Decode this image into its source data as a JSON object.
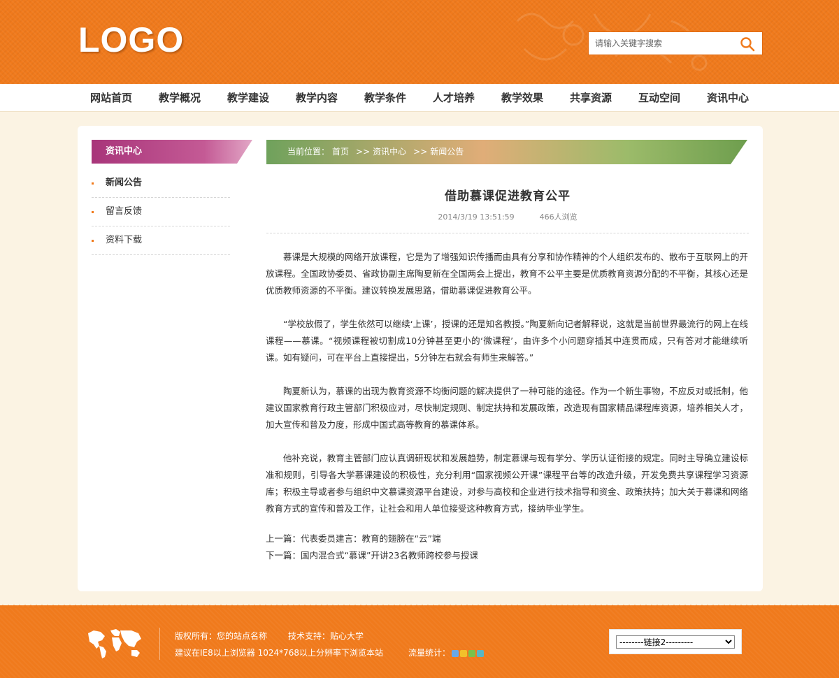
{
  "header": {
    "logo": "LOGO",
    "search": {
      "placeholder": "请输入关键字搜索",
      "icon": "search-icon"
    }
  },
  "nav": {
    "items": [
      "网站首页",
      "教学概况",
      "教学建设",
      "教学内容",
      "教学条件",
      "人才培养",
      "教学效果",
      "共享资源",
      "互动空间",
      "资讯中心"
    ]
  },
  "sidebar": {
    "title": "资讯中心",
    "items": [
      "新闻公告",
      "留言反馈",
      "资料下载"
    ],
    "active": 0
  },
  "breadcrumb": {
    "label": "当前位置：",
    "items": [
      "首页",
      "资讯中心",
      "新闻公告"
    ]
  },
  "article": {
    "title": "借助慕课促进教育公平",
    "date": "2014/3/19 13:51:59",
    "views": "466人浏览",
    "paragraphs": [
      "慕课是大规模的网络开放课程，它是为了增强知识传播而由具有分享和协作精神的个人组织发布的、散布于互联网上的开放课程。全国政协委员、省政协副主席陶夏新在全国两会上提出，教育不公平主要是优质教育资源分配的不平衡，其核心还是优质教师资源的不平衡。建议转换发展思路，借助慕课促进教育公平。",
      "“学校放假了，学生依然可以继续‘上课’，授课的还是知名教授。”陶夏新向记者解释说，这就是当前世界最流行的网上在线课程——慕课。“视频课程被切割成10分钟甚至更小的‘微课程’，由许多个小问题穿插其中连贯而成，只有答对才能继续听课。如有疑问，可在平台上直接提出，5分钟左右就会有师生来解答。”",
      "陶夏新认为，慕课的出现为教育资源不均衡问题的解决提供了一种可能的途径。作为一个新生事物，不应反对或抵制，他建议国家教育行政主管部门积极应对，尽快制定规则、制定扶持和发展政策，改造现有国家精品课程库资源，培养相关人才，加大宣传和普及力度，形成中国式高等教育的慕课体系。",
      "他补充说，教育主管部门应认真调研现状和发展趋势，制定慕课与现有学分、学历认证衔接的规定。同时主导确立建设标准和规则，引导各大学慕课建设的积极性，充分利用“国家视频公开课”课程平台等的改造升级，开发免费共享课程学习资源库；积极主导或者参与组织中文慕课资源平台建设，对参与高校和企业进行技术指导和资金、政策扶持；加大关于慕课和网络教育方式的宣传和普及工作，让社会和用人单位接受这种教育方式，接纳毕业学生。"
    ],
    "prev": "上一篇：代表委员建言：教育的翅膀在“云”端",
    "next": "下一篇：国内混合式“慕课”开讲23名教师跨校参与授课"
  },
  "footer": {
    "copyright": "版权所有：您的站点名称",
    "tech": "技术支持：贴心大学",
    "browser": "建议在IE8以上浏览器 1024*768以上分辨率下浏览本站",
    "stats": "流量统计：",
    "links_select": "--------链接2---------"
  },
  "colors": {
    "brand_orange": "#f07a1c",
    "sidebar_pink": "#b8457f",
    "breadcrumb_green": "#7aaa5e",
    "page_bg": "#fbf3e3"
  }
}
